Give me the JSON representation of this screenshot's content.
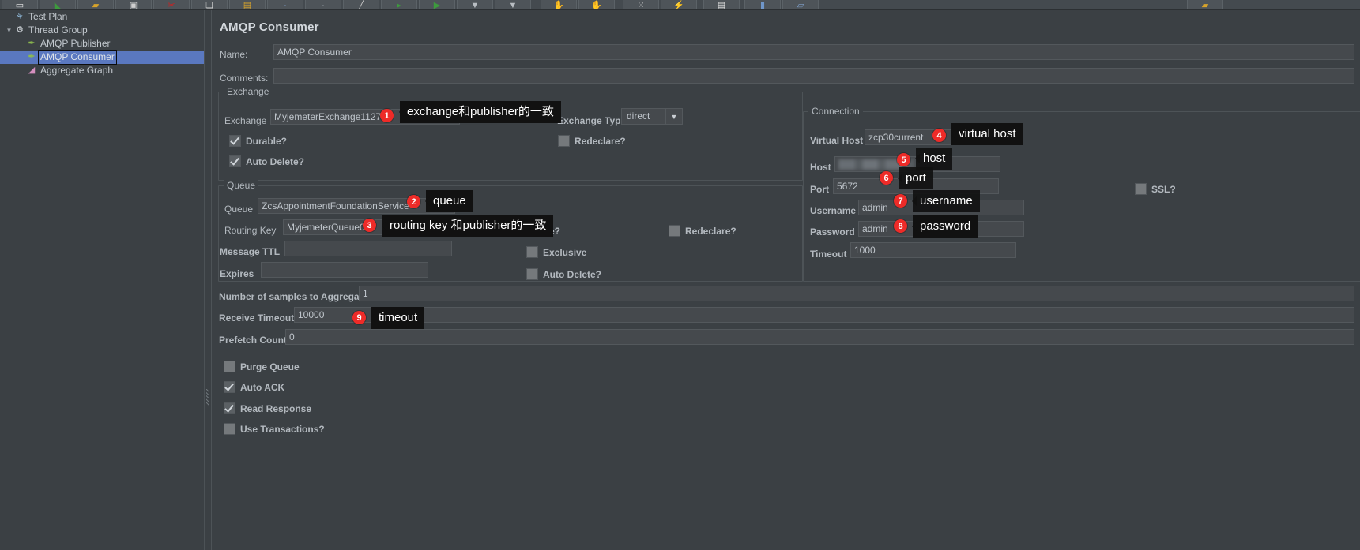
{
  "toolbar": {
    "buttons": [
      {
        "name": "new",
        "glyph": "▭"
      },
      {
        "name": "templates",
        "glyph": "◣"
      },
      {
        "name": "open",
        "glyph": "▰"
      },
      {
        "name": "save-as",
        "glyph": "▣"
      },
      {
        "name": "close",
        "glyph": "✂"
      },
      {
        "name": "cut",
        "glyph": "❏"
      },
      {
        "name": "copy",
        "glyph": "▤"
      },
      {
        "name": "paste",
        "glyph": "·"
      },
      {
        "name": "expand",
        "glyph": "·"
      },
      {
        "name": "collapse",
        "glyph": "╱"
      },
      {
        "name": "toggle",
        "glyph": "▸"
      },
      {
        "name": "start",
        "glyph": "▶"
      },
      {
        "name": "start-no-pauses",
        "glyph": "▼"
      },
      {
        "name": "stop",
        "glyph": "▼"
      },
      {
        "name": "shutdown",
        "glyph": "✋"
      },
      {
        "name": "clear",
        "glyph": "✋"
      },
      {
        "name": "clear-all",
        "glyph": "⁙"
      },
      {
        "name": "search",
        "glyph": "⚡"
      },
      {
        "name": "reset-search",
        "glyph": "▤"
      },
      {
        "name": "function-helper",
        "glyph": "▮"
      },
      {
        "name": "help",
        "glyph": "▱"
      },
      {
        "name": "warning",
        "glyph": "▰"
      }
    ]
  },
  "tree": {
    "items": [
      {
        "label": "Test Plan",
        "icon": "test-plan-icon",
        "indent": 0,
        "twisty": "",
        "selected": false
      },
      {
        "label": "Thread Group",
        "icon": "thread-group-icon",
        "indent": 0,
        "twisty": "▼",
        "selected": false
      },
      {
        "label": "AMQP Publisher",
        "icon": "sampler-icon",
        "indent": 1,
        "twisty": "",
        "selected": false
      },
      {
        "label": "AMQP Consumer",
        "icon": "sampler-icon",
        "indent": 1,
        "twisty": "",
        "selected": true
      },
      {
        "label": "Aggregate Graph",
        "icon": "listener-icon",
        "indent": 1,
        "twisty": "",
        "selected": false
      }
    ]
  },
  "panel": {
    "title": "AMQP Consumer",
    "name_label": "Name:",
    "name_value": "AMQP Consumer",
    "comments_label": "Comments:",
    "comments_value": ""
  },
  "exchange_group": {
    "caption": "Exchange",
    "exchange_label": "Exchange",
    "exchange_value": "MyjemeterExchange1127",
    "exchange_type_label": "Exchange Type",
    "exchange_type_value": "direct",
    "exchange_type_arrow": "▼",
    "durable_label": "Durable?",
    "durable_checked": true,
    "redeclare_label": "Redeclare?",
    "redeclare_checked": false,
    "auto_delete_label": "Auto Delete?",
    "auto_delete_checked": true
  },
  "queue_group": {
    "caption": "Queue",
    "queue_label": "Queue",
    "queue_value": "ZcsAppointmentFoundationService",
    "routing_key_label": "Routing Key",
    "routing_key_value": "MyjemeterQueue01",
    "message_ttl_label": "Message TTL",
    "message_ttl_value": "",
    "expires_label": "Expires",
    "expires_value": "",
    "durable_label": "Durable?",
    "durable_checked": true,
    "redeclare_label": "Redeclare?",
    "redeclare_checked": false,
    "exclusive_label": "Exclusive",
    "exclusive_checked": false,
    "auto_delete_label": "Auto Delete?",
    "auto_delete_checked": false
  },
  "connection_group": {
    "caption": "Connection",
    "virtual_host_label": "Virtual Host",
    "virtual_host_value": "zcp30current",
    "host_label": "Host",
    "host_value": "",
    "port_label": "Port",
    "port_value": "5672",
    "username_label": "Username",
    "username_value": "admin",
    "password_label": "Password",
    "password_value": "admin",
    "timeout_label": "Timeout",
    "timeout_value": "1000",
    "ssl_label": "SSL?",
    "ssl_checked": false
  },
  "bottom": {
    "samples_label": "Number of samples to Aggregate",
    "samples_value": "1",
    "receive_timeout_label": "Receive Timeout",
    "receive_timeout_value": "10000",
    "prefetch_label": "Prefetch Count",
    "prefetch_value": "0",
    "purge_queue_label": "Purge Queue",
    "purge_queue_checked": false,
    "auto_ack_label": "Auto ACK",
    "auto_ack_checked": true,
    "read_response_label": "Read Response",
    "read_response_checked": true,
    "use_transactions_label": "Use Transactions?",
    "use_transactions_checked": false
  },
  "annotations": {
    "accent_color": "#ee2b28",
    "items": [
      {
        "num": "1",
        "text": "exchange和publisher的一致"
      },
      {
        "num": "2",
        "text": "queue"
      },
      {
        "num": "3",
        "text": "routing key 和publisher的一致"
      },
      {
        "num": "4",
        "text": "virtual host"
      },
      {
        "num": "5",
        "text": "host"
      },
      {
        "num": "6",
        "text": "port"
      },
      {
        "num": "7",
        "text": "username"
      },
      {
        "num": "8",
        "text": "password"
      },
      {
        "num": "9",
        "text": "timeout"
      }
    ]
  }
}
